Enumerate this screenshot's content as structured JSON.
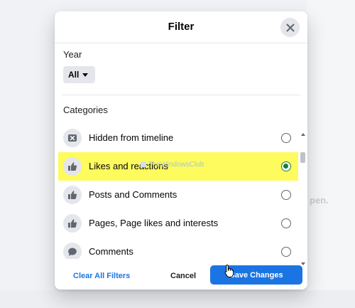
{
  "background": {
    "partial_text": "pen."
  },
  "modal": {
    "title": "Filter",
    "close_icon": "close-icon",
    "year_label": "Year",
    "year_value": "All",
    "categories_label": "Categories"
  },
  "categories": [
    {
      "label": "Hidden from timeline",
      "icon": "hidden-x-icon",
      "selected": false
    },
    {
      "label": "Likes and reactions",
      "icon": "thumbs-up-icon",
      "selected": true
    },
    {
      "label": "Posts and Comments",
      "icon": "thumbs-up-icon",
      "selected": false
    },
    {
      "label": "Pages, Page likes and interests",
      "icon": "thumbs-up-icon",
      "selected": false
    },
    {
      "label": "Comments",
      "icon": "comment-bubble-icon",
      "selected": false
    }
  ],
  "watermark": "TheWindowsClub",
  "footer": {
    "clear_label": "Clear All Filters",
    "cancel_label": "Cancel",
    "save_label": "Save Changes"
  },
  "colors": {
    "accent": "#1b74e4",
    "highlight": "#fdfb5e",
    "selected_radio": "#1b7a3a"
  }
}
